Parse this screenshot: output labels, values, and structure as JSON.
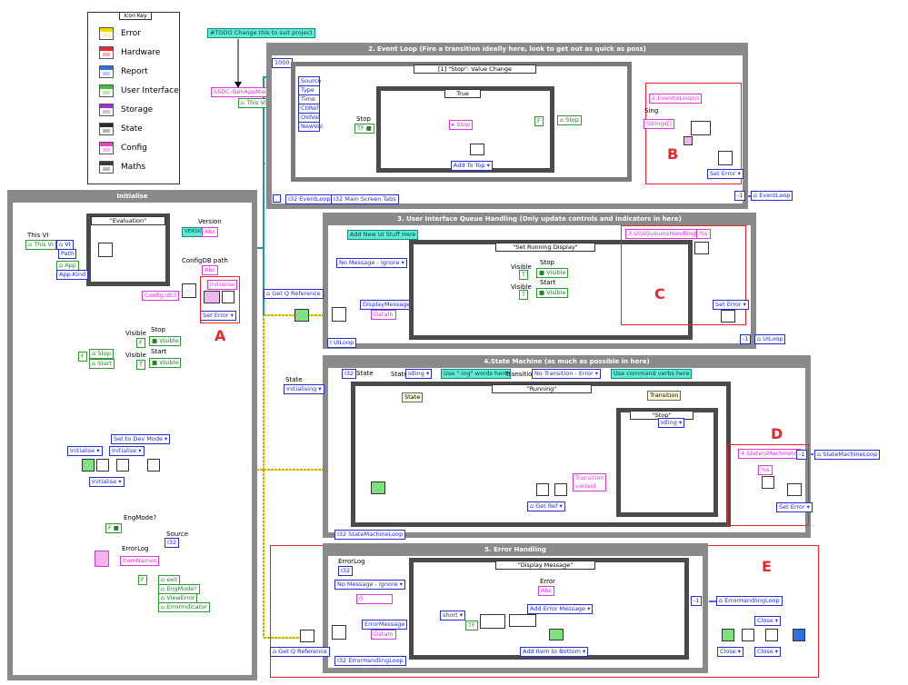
{
  "icon_key": {
    "title": "Icon Key",
    "items": [
      {
        "badge": "ERROR",
        "label": "Error",
        "color": "#f3d700"
      },
      {
        "badge": "HWC",
        "label": "Hardware",
        "color": "#e8262e"
      },
      {
        "badge": "REPORT",
        "label": "Report",
        "color": "#2f6fe0"
      },
      {
        "badge": "UI",
        "label": "User Interface",
        "color": "#3fc03f"
      },
      {
        "badge": "STORE",
        "label": "Storage",
        "color": "#a033cc"
      },
      {
        "badge": "STATE",
        "label": "State",
        "color": "#2a2a2a"
      },
      {
        "badge": "CONFIG",
        "label": "Config",
        "color": "#e840c8"
      },
      {
        "badge": "MATHS",
        "label": "Maths",
        "color": "#3a3a3a"
      }
    ]
  },
  "todo_note": "#TODO Change this to suit project",
  "app_name": "SSDC-GenAppMain",
  "this_vi": "This VI",
  "initialise": {
    "title": "Initialise",
    "case": "\"Evaluation\"",
    "this_vi": "This VI",
    "vi": "VI",
    "path": "Path",
    "app": "App",
    "app_kind": "App.Kind",
    "version_label": "Version",
    "version_badge": "VERSION",
    "configdb_label": "ConfigDB path",
    "config_file": "Config.db3",
    "init_str": "Initialise",
    "set_error": "Set Error",
    "visible": "Visible",
    "stop": "Stop",
    "start": "Start",
    "visible_prop": "Visible",
    "f_const": "F",
    "t_const": "T",
    "set_dev_mode": "Set to Dev Mode",
    "init1": "Initialise",
    "init2": "Initialise",
    "init3": "Initialise",
    "engmode": "EngMode?",
    "source_label": "Source",
    "source_badge": "I32",
    "errorlog_label": "ErrorLog",
    "item_names": "ItemNames",
    "refs": [
      "exit",
      "EngMode?",
      "ViewError",
      "ErrorIndicator"
    ],
    "stop_ref": "Stop",
    "start_ref": "Start"
  },
  "event_loop": {
    "title": "2. Event Loop (Fire a transition ideally here, look to get out as quick as poss)",
    "timeout": "1000",
    "event_case": "[1] \"Stop\": Value Change",
    "event_data": [
      "Source",
      "Type",
      "Time",
      "CtlRef",
      "OldVal",
      "NewVal"
    ],
    "case_true": "True",
    "stop_label": "Stop",
    "stop_ref": "Stop",
    "add_to_top": "Add To Top",
    "loop_label": "EventLoop",
    "tabs_label": "Main Screen Tabs",
    "state_badge": "STATE",
    "error_badge": "ERROR",
    "error_msg": "2.Event\\sLoop\\n",
    "string_label": "Sing",
    "strings_label": "Strings[]",
    "set_error": "Set Error",
    "out_ref": "EventLoop"
  },
  "ui_loop": {
    "title": "3. User Interface Queue Handling (Only update controls and indicators in here)",
    "add_ui_note": "Add New UI Stuff Here",
    "no_message": "No Message - Ignore",
    "get_q_ref": "Get Q Reference",
    "case": "\"Set Running Display\"",
    "display_message": "DisplayMessage",
    "data_in": "DataIn",
    "stop_label": "Stop",
    "start_label": "Start",
    "visible": "Visible",
    "error_msg": "3.UI\\sQueue\\sHandling\\n",
    "pct_s": "%s",
    "set_error": "Set Error",
    "loop_label": "UILoop",
    "out_ref": "UILoop"
  },
  "state_machine": {
    "title": "4.State Machine (as much as possible in here)",
    "state_label": "State",
    "state_init": "Initialising",
    "state_idling": "Idling",
    "use_ing_note": "Use \"-ing\" words here",
    "transition_label": "Transition",
    "no_transition": "No Transition - Error",
    "verbs_note": "Use command verbs here",
    "running_case": "\"Running\"",
    "state_tag": "State",
    "transition_tag": "Transition",
    "stop_case": "\"Stop\"",
    "idling": "Idling",
    "get_ref": "Get Ref",
    "transition_variant": "Transition",
    "variant": "variant",
    "error_msg": "4.State\\sMachine\\n",
    "pct_s": "%s",
    "set_error": "Set Error",
    "loop_label": "StateMachineLoop",
    "out_ref": "StateMachineLoop"
  },
  "error_handling": {
    "title": "5. Error Handling",
    "errorlog_label": "ErrorLog",
    "errorlog_badge": "I32",
    "no_message": "No Message - Ignore",
    "case": "\"Display Message\"",
    "error_label": "Error",
    "error_badge": "Abc",
    "zero": "0",
    "error_message": "ErrorMessage",
    "data_in": "DataIn",
    "short": "short",
    "add_error_message": "Add Error Message",
    "add_item_bottom": "Add Item to Bottom",
    "get_q_ref": "Get Q Reference",
    "loop_label": "ErrorHandlingLoop",
    "out_ref": "ErrorHandlingLoop",
    "close1": "Close",
    "close2": "Close",
    "close3": "Close"
  },
  "letters": {
    "a": "A",
    "b": "B",
    "c": "C",
    "d": "D",
    "e": "E"
  },
  "colors": {
    "frame": "#8a8a8a",
    "wire_error": "#c8b400",
    "wire_blue": "#2430c8",
    "wire_pink": "#e840c8",
    "wire_teal": "#1a9a9a",
    "highlight": "#e8262e"
  }
}
